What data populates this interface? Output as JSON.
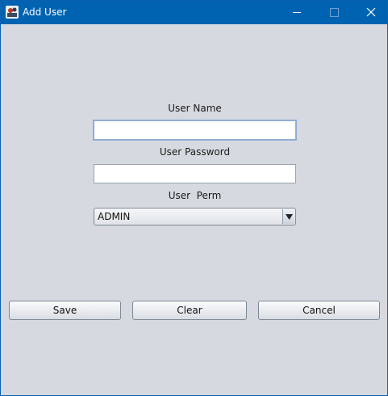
{
  "window": {
    "title": "Add User",
    "titlebar_color": "#0063b1",
    "background_color": "#d7d9e0"
  },
  "titlebar_buttons": {
    "minimize_icon": "minimize-icon",
    "maximize_icon": "maximize-icon",
    "close_icon": "close-icon"
  },
  "form": {
    "user_name_label": "User Name",
    "user_name_value": "",
    "user_password_label": "User Password",
    "user_password_value": "",
    "user_perm_label": "User  Perm",
    "user_perm_selected": "ADMIN"
  },
  "buttons": {
    "save_label": "Save",
    "clear_label": "Clear",
    "cancel_label": "Cancel"
  }
}
